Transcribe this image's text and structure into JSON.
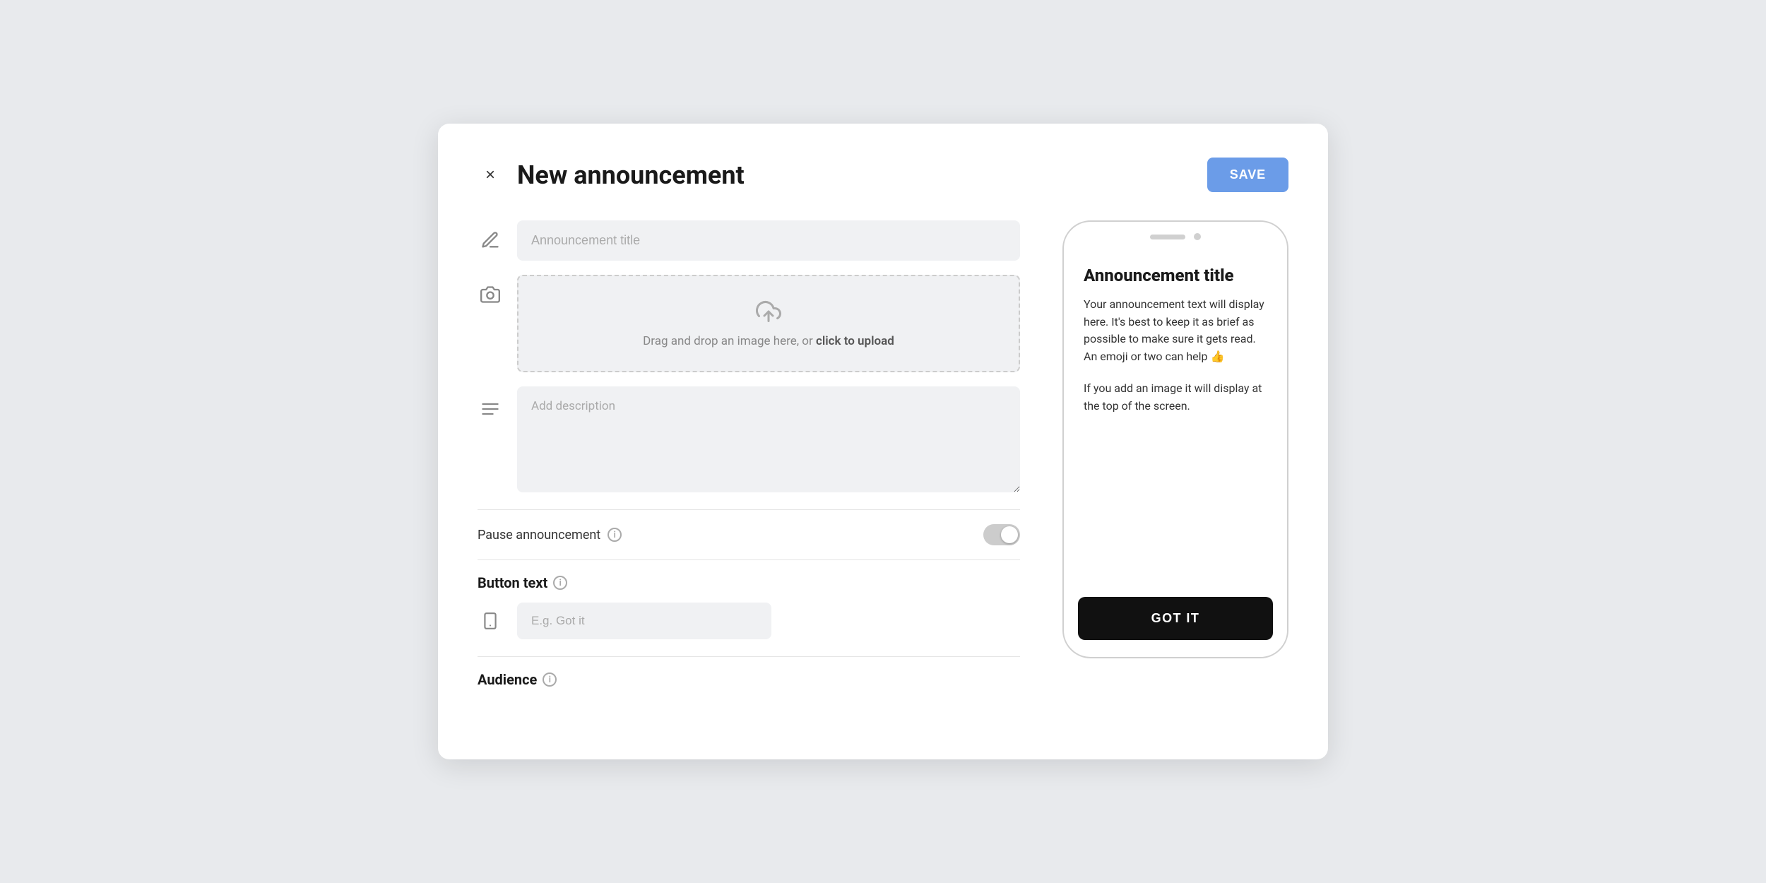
{
  "modal": {
    "title": "New announcement",
    "close_icon": "×",
    "save_button": "SAVE"
  },
  "form": {
    "title_placeholder": "Announcement title",
    "upload_text": "Drag and drop an image here, or ",
    "upload_link": "click to upload",
    "description_placeholder": "Add description",
    "pause_label": "Pause announcement",
    "button_text_label": "Button text",
    "button_text_placeholder": "E.g. Got it",
    "audience_label": "Audience"
  },
  "phone_preview": {
    "announcement_title": "Announcement title",
    "body_text": "Your announcement text will display here. It's best to keep it as brief as possible to make sure it gets read. An emoji or two can help 👍",
    "image_note": "If you add an image it will display at the top of the screen.",
    "cta_button": "GOT IT"
  },
  "icons": {
    "close": "×",
    "pencil": "✏",
    "camera": "📷",
    "lines": "≡",
    "phone": "📱",
    "info": "i",
    "upload_arrow": "↑"
  }
}
